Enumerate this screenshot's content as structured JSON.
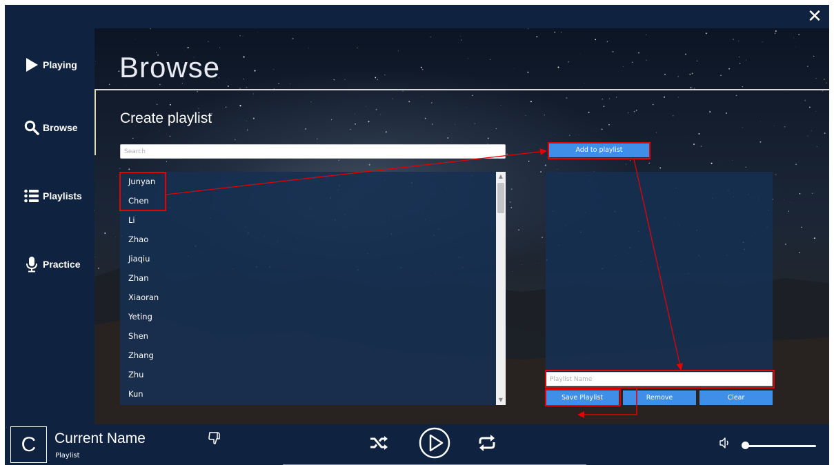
{
  "window": {
    "close_icon": "close-icon"
  },
  "sidebar": {
    "items": [
      {
        "label": "Playing",
        "icon": "play-icon"
      },
      {
        "label": "Browse",
        "icon": "search-icon"
      },
      {
        "label": "Playlists",
        "icon": "list-icon"
      },
      {
        "label": "Practice",
        "icon": "microphone-icon"
      }
    ],
    "active": "Browse"
  },
  "header": {
    "title": "Browse",
    "section_title": "Create playlist"
  },
  "search": {
    "placeholder": "Search",
    "value": ""
  },
  "songs": [
    "Junyan",
    "Chen",
    "Li",
    "Zhao",
    "Jiaqiu",
    "Zhan",
    "Xiaoran",
    "Yeting",
    "Shen",
    "Zhang",
    "Zhu",
    "Kun"
  ],
  "playlist_panel": {
    "add_label": "Add to playlist",
    "name_placeholder": "Playlist Name",
    "save_label": "Save Playlist",
    "remove_label": "Remove",
    "clear_label": "Clear"
  },
  "player": {
    "avatar_letter": "C",
    "track_name": "Current Name",
    "track_sub": "Playlist",
    "icons": [
      "thumbs-down-icon",
      "shuffle-icon",
      "play-circle-icon",
      "repeat-icon",
      "volume-icon"
    ]
  },
  "colors": {
    "background": "#0f2240",
    "button": "#3f8fe8",
    "list_panel": "#163052",
    "annotation": "#e60000"
  }
}
